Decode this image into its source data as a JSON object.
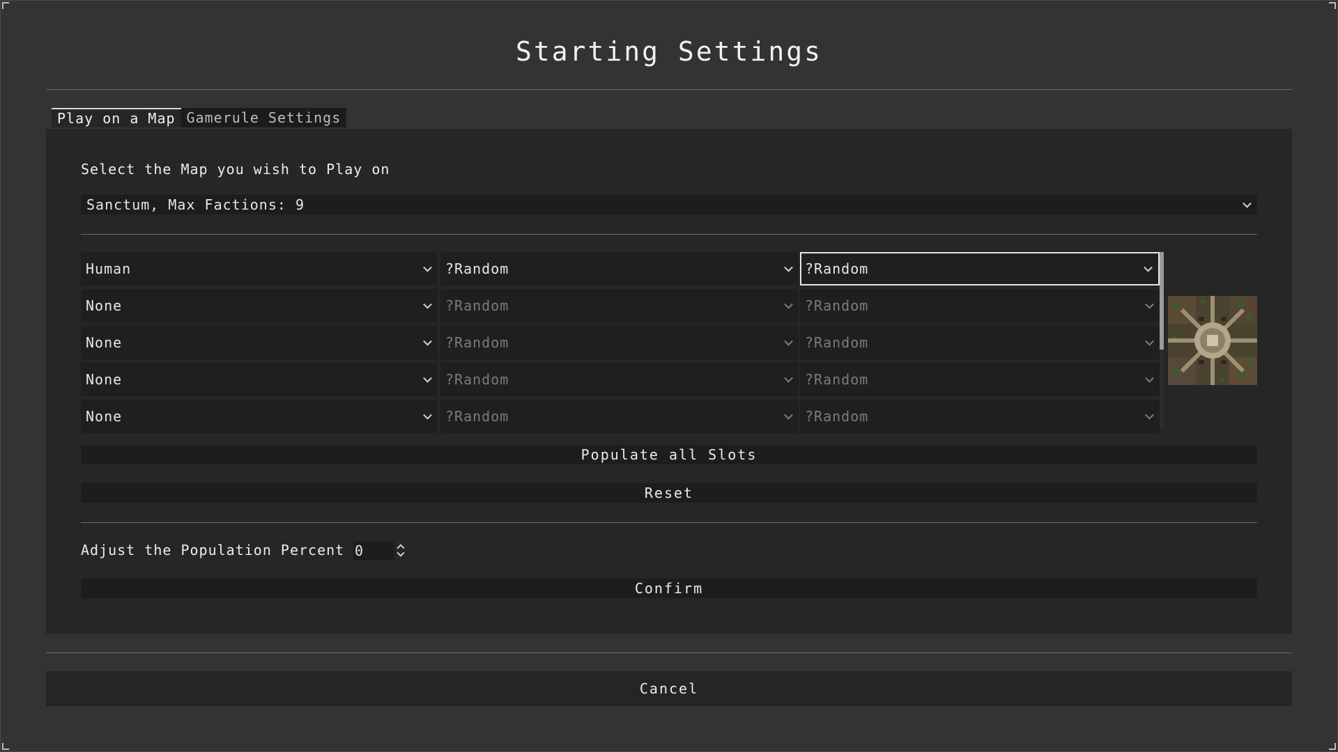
{
  "dialog": {
    "title": "Starting Settings",
    "tabs": [
      {
        "label": "Play on a Map",
        "active": true
      },
      {
        "label": "Gamerule Settings",
        "active": false
      }
    ],
    "map_prompt": "Select the Map you wish to Play on",
    "map_select": {
      "value": "Sanctum, Max Factions: 9"
    },
    "slots": [
      {
        "player": "Human",
        "faction": "?Random",
        "team": "?Random",
        "enabled": true
      },
      {
        "player": "None",
        "faction": "?Random",
        "team": "?Random",
        "enabled": false
      },
      {
        "player": "None",
        "faction": "?Random",
        "team": "?Random",
        "enabled": false
      },
      {
        "player": "None",
        "faction": "?Random",
        "team": "?Random",
        "enabled": false
      },
      {
        "player": "None",
        "faction": "?Random",
        "team": "?Random",
        "enabled": false
      }
    ],
    "populate_label": "Populate all Slots",
    "reset_label": "Reset",
    "population_label": "Adjust the Population Percent",
    "population_value": "0",
    "confirm_label": "Confirm",
    "cancel_label": "Cancel"
  },
  "colors": {
    "background": "#333333",
    "panel": "#262626",
    "field": "#1f1f1f",
    "text": "#e8e8e8",
    "dim_text": "#7c7c7c"
  },
  "icons": [
    "chevron-down-icon",
    "spin-up-icon",
    "spin-down-icon",
    "map-thumbnail"
  ]
}
